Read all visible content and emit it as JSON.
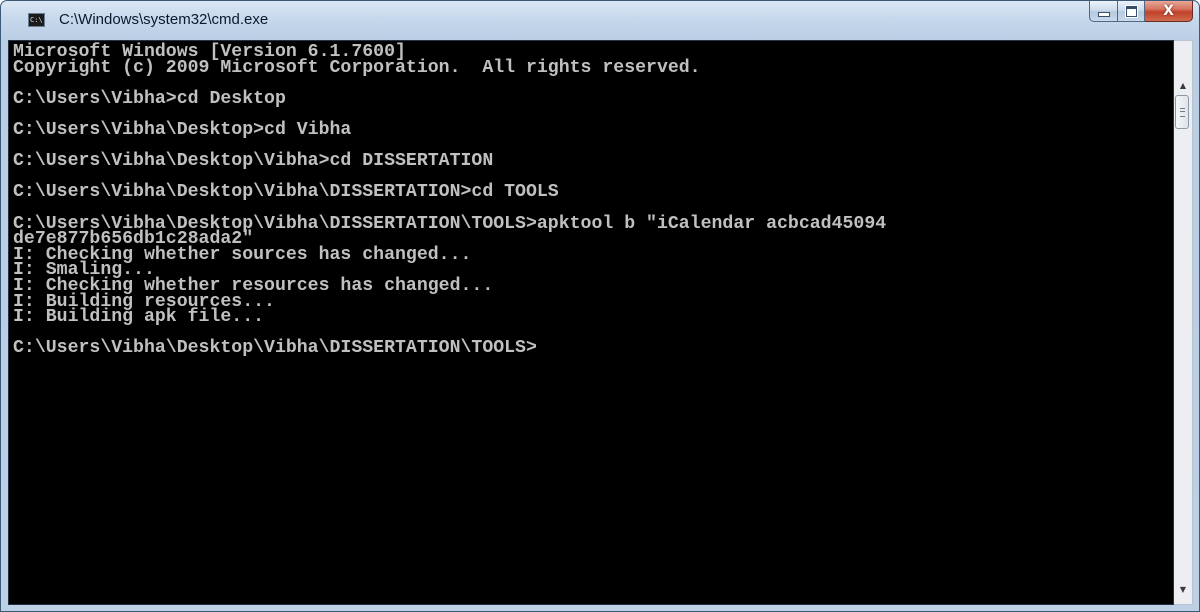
{
  "window": {
    "title": "C:\\Windows\\system32\\cmd.exe",
    "icon": "cmd-icon",
    "icon_text": "C:\\",
    "buttons": {
      "minimize_icon": "minimize-icon",
      "maximize_icon": "maximize-icon",
      "close_icon": "close-icon",
      "close_glyph": "X"
    }
  },
  "console": {
    "lines": [
      "Microsoft Windows [Version 6.1.7600]",
      "Copyright (c) 2009 Microsoft Corporation.  All rights reserved.",
      "",
      "C:\\Users\\Vibha>cd Desktop",
      "",
      "C:\\Users\\Vibha\\Desktop>cd Vibha",
      "",
      "C:\\Users\\Vibha\\Desktop\\Vibha>cd DISSERTATION",
      "",
      "C:\\Users\\Vibha\\Desktop\\Vibha\\DISSERTATION>cd TOOLS",
      "",
      "C:\\Users\\Vibha\\Desktop\\Vibha\\DISSERTATION\\TOOLS>apktool b \"iCalendar acbcad45094",
      "de7e877b656db1c28ada2\"",
      "I: Checking whether sources has changed...",
      "I: Smaling...",
      "I: Checking whether resources has changed...",
      "I: Building resources...",
      "I: Building apk file...",
      "",
      "C:\\Users\\Vibha\\Desktop\\Vibha\\DISSERTATION\\TOOLS>"
    ],
    "colors": {
      "background": "#000000",
      "text": "#c0c0c0"
    }
  },
  "scrollbar": {
    "up_arrow": "▲",
    "down_arrow": "▼"
  }
}
